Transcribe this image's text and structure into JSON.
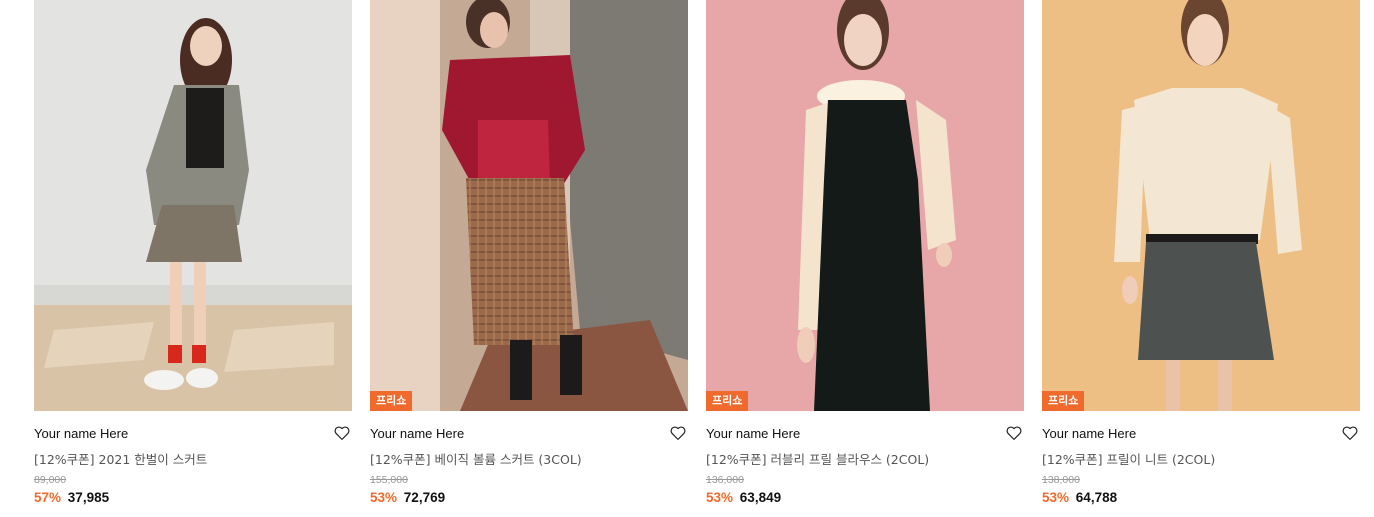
{
  "products": [
    {
      "brand": "Your name Here",
      "title": "[12%쿠폰] 2021 한벌이 스커트",
      "original_price": "89,000",
      "discount": "57%",
      "price": "37,985",
      "badge": ""
    },
    {
      "brand": "Your name Here",
      "title": "[12%쿠폰] 베이직 볼륨 스커트 (3COL)",
      "original_price": "155,000",
      "discount": "53%",
      "price": "72,769",
      "badge": "프리쇼"
    },
    {
      "brand": "Your name Here",
      "title": "[12%쿠폰] 러블리 프릴 블라우스 (2COL)",
      "original_price": "136,000",
      "discount": "53%",
      "price": "63,849",
      "badge": "프리쇼"
    },
    {
      "brand": "Your name Here",
      "title": "[12%쿠폰] 프릴이 니트 (2COL)",
      "original_price": "138,000",
      "discount": "53%",
      "price": "64,788",
      "badge": "프리쇼"
    }
  ],
  "icons": {
    "wishlist": "heart-outline-icon"
  },
  "colors": {
    "accent": "#f06a2d",
    "text": "#111111",
    "muted": "#999999"
  }
}
